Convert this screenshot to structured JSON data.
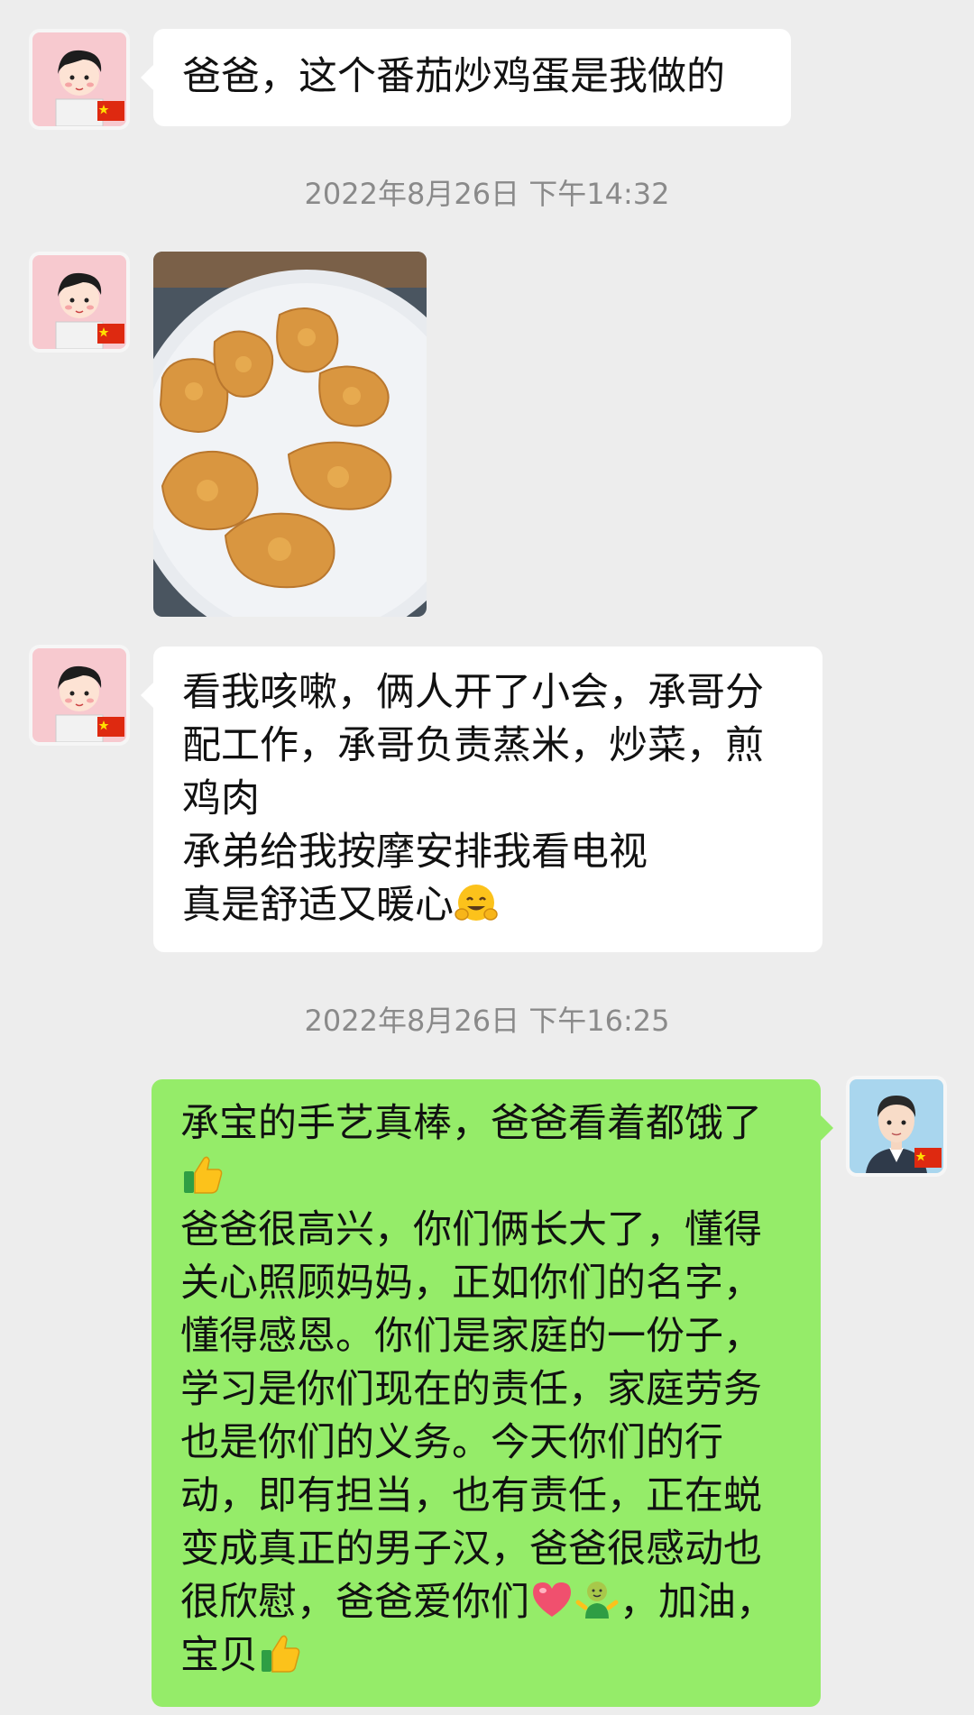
{
  "messages": {
    "m1": {
      "sender": "mom",
      "text": "爸爸，这个番茄炒鸡蛋是我做的"
    },
    "ts1": "2022年8月26日 下午14:32",
    "m2": {
      "sender": "mom",
      "type": "image",
      "image_subject": "fried-food-on-plate"
    },
    "m3": {
      "sender": "mom",
      "lines": [
        "看我咳嗽，俩人开了小会，承哥分",
        "配工作，承哥负责蒸米，炒菜，煎",
        "鸡肉",
        "承弟给我按摩安排我看电视",
        "真是舒适又暖心"
      ]
    },
    "ts2": "2022年8月26日 下午16:25",
    "m4": {
      "sender": "dad",
      "lines": [
        "承宝的手艺真棒，爸爸看着都饿了",
        "",
        "爸爸很高兴，你们俩长大了，懂得",
        "关心照顾妈妈，正如你们的名字，",
        "懂得感恩。你们是家庭的一份子，",
        "学习是你们现在的责任，家庭劳务",
        "也是你们的义务。今天你们的行",
        "动，即有担当，也有责任，正在蜕",
        "变成真正的男子汉，爸爸很感动也",
        "很欣慰，爸爸爱你们",
        "，加油，",
        "宝贝"
      ]
    }
  },
  "colors": {
    "background": "#ededed",
    "incoming_bubble": "#ffffff",
    "outgoing_bubble": "#95ec69",
    "timestamp": "#8a8a8a"
  },
  "icons": {
    "flag": "china-flag-icon",
    "emoji_hug": "hugging-face-emoji",
    "emoji_thumb": "thumbs-up-emoji",
    "emoji_heart": "red-heart-emoji",
    "emoji_person": "person-shrugging-emoji"
  }
}
